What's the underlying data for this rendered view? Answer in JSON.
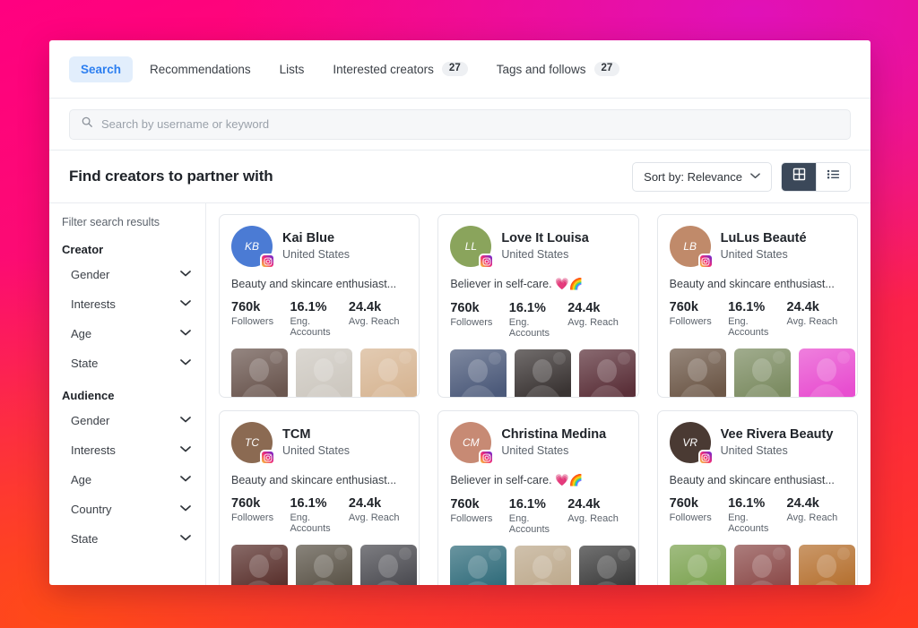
{
  "tabs": [
    {
      "label": "Search",
      "badge": null,
      "active": true
    },
    {
      "label": "Recommendations",
      "badge": null,
      "active": false
    },
    {
      "label": "Lists",
      "badge": null,
      "active": false
    },
    {
      "label": "Interested creators",
      "badge": "27",
      "active": false
    },
    {
      "label": "Tags and follows",
      "badge": "27",
      "active": false
    }
  ],
  "search": {
    "placeholder": "Search by username or keyword",
    "value": "",
    "icon": "search-icon"
  },
  "header": {
    "title": "Find creators to partner with",
    "sort_label": "Sort by: Relevance",
    "view_grid": "grid-view",
    "view_list": "list-view"
  },
  "sidebar": {
    "title": "Filter search results",
    "groups": [
      {
        "label": "Creator",
        "items": [
          "Gender",
          "Interests",
          "Age",
          "State"
        ]
      },
      {
        "label": "Audience",
        "items": [
          "Gender",
          "Interests",
          "Age",
          "Country",
          "State"
        ]
      }
    ]
  },
  "stat_labels": [
    "Followers",
    "Eng. Accounts",
    "Avg. Reach"
  ],
  "cards": [
    {
      "name": "Kai Blue",
      "location": "United States",
      "bio": "Beauty and skincare enthusiast...",
      "platform": "instagram",
      "stats": [
        "760k",
        "16.1%",
        "24.4k"
      ],
      "avatar_color": "#4b7bd4",
      "avatar_text": "KB",
      "thumbs": [
        "#6b5750",
        "#cdc8c0",
        "#d7b694"
      ]
    },
    {
      "name": "Love It Louisa",
      "location": "United States",
      "bio": "Believer in self-care. 💗🌈",
      "platform": "instagram",
      "stats": [
        "760k",
        "16.1%",
        "24.4k"
      ],
      "avatar_color": "#8aa45c",
      "avatar_text": "LL",
      "thumbs": [
        "#4c5a7a",
        "#3a3433",
        "#5b3039"
      ]
    },
    {
      "name": "LuLus Beauté",
      "location": "United States",
      "bio": "Beauty and skincare enthusiast...",
      "platform": "instagram",
      "stats": [
        "760k",
        "16.1%",
        "24.4k"
      ],
      "avatar_color": "#c08a6a",
      "avatar_text": "LB",
      "thumbs": [
        "#6d5848",
        "#7c8c62",
        "#e84ed0"
      ]
    },
    {
      "name": "TCM",
      "location": "United States",
      "bio": "Beauty and skincare enthusiast...",
      "platform": "instagram",
      "stats": [
        "760k",
        "16.1%",
        "24.4k"
      ],
      "avatar_color": "#8b6a52",
      "avatar_text": "TC",
      "thumbs": [
        "#59302c",
        "#5a5347",
        "#4a4a50"
      ]
    },
    {
      "name": "Christina Medina",
      "location": "United States",
      "bio": "Believer in self-care. 💗🌈",
      "platform": "instagram",
      "stats": [
        "760k",
        "16.1%",
        "24.4k"
      ],
      "avatar_color": "#c78a74",
      "avatar_text": "CM",
      "thumbs": [
        "#2f6b7a",
        "#bda98c",
        "#3a3a3a"
      ]
    },
    {
      "name": "Vee Rivera Beauty",
      "location": "United States",
      "bio": "Beauty and skincare enthusiast...",
      "platform": "instagram",
      "stats": [
        "760k",
        "16.1%",
        "24.4k"
      ],
      "avatar_color": "#4a3a33",
      "avatar_text": "VR",
      "thumbs": [
        "#7ba24f",
        "#8b4a49",
        "#b5702f"
      ]
    }
  ],
  "colors": {
    "accent": "#2d7ff0",
    "accent_bg": "#e2eefc",
    "dark": "#3b4859",
    "text": "#1f2329",
    "muted": "#5c636c",
    "border": "#e9ecf0"
  }
}
